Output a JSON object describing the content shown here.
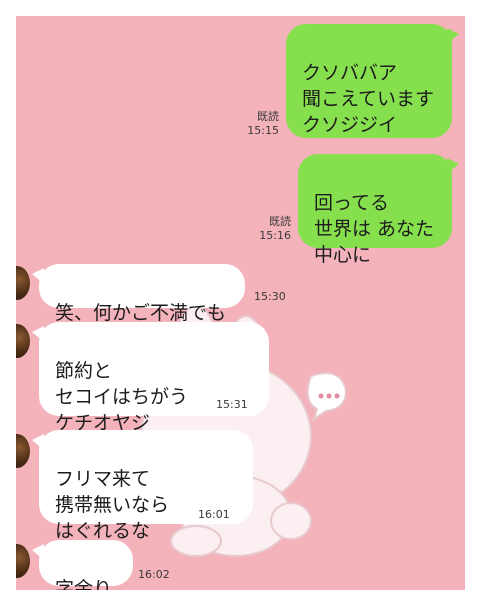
{
  "messages_out": [
    {
      "text": "クソババア\n聞こえています\nクソジジイ",
      "read": "既読",
      "time": "15:15"
    },
    {
      "text": "回ってる\n世界は あなた\n中心に",
      "read": "既読",
      "time": "15:16"
    }
  ],
  "messages_in": [
    {
      "text": "笑、何かご不満でも",
      "time": "15:30"
    },
    {
      "text": "節約と\nセコイはちがう\nケチオヤジ",
      "time": "15:31"
    },
    {
      "text": "フリマ来て\n携帯無いなら\nはぐれるな",
      "time": "16:01"
    },
    {
      "text": "字余り",
      "time": "16:02"
    }
  ],
  "colors": {
    "background": "#f4b2bb",
    "outgoing": "#86e04e",
    "incoming": "#ffffff"
  }
}
